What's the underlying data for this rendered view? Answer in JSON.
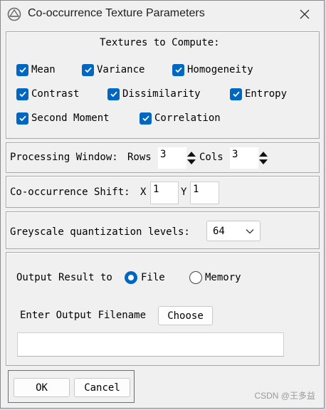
{
  "window": {
    "title": "Co-occurrence Texture Parameters"
  },
  "textures": {
    "heading": "Textures to Compute:",
    "items": [
      {
        "label": "Mean",
        "checked": true
      },
      {
        "label": "Variance",
        "checked": true
      },
      {
        "label": "Homogeneity",
        "checked": true
      },
      {
        "label": "Contrast",
        "checked": true
      },
      {
        "label": "Dissimilarity",
        "checked": true
      },
      {
        "label": "Entropy",
        "checked": true
      },
      {
        "label": "Second Moment",
        "checked": true
      },
      {
        "label": "Correlation",
        "checked": true
      }
    ]
  },
  "processing": {
    "label": "Processing Window:",
    "rows_label": "Rows",
    "rows_value": "3",
    "cols_label": "Cols",
    "cols_value": "3"
  },
  "shift": {
    "label": "Co-occurrence Shift:",
    "x_label": "X",
    "x_value": "1",
    "y_label": "Y",
    "y_value": "1"
  },
  "greyscale": {
    "label": "Greyscale quantization levels:",
    "selected": "64"
  },
  "output": {
    "label": "Output Result to",
    "file_label": "File",
    "memory_label": "Memory",
    "selected": "File",
    "filename_label": "Enter Output Filename",
    "choose_label": "Choose",
    "filename_value": ""
  },
  "buttons": {
    "ok": "OK",
    "cancel": "Cancel"
  },
  "watermark": "CSDN @王多益",
  "colors": {
    "accent": "#0067c0",
    "window_bg": "#f0f0f0"
  }
}
